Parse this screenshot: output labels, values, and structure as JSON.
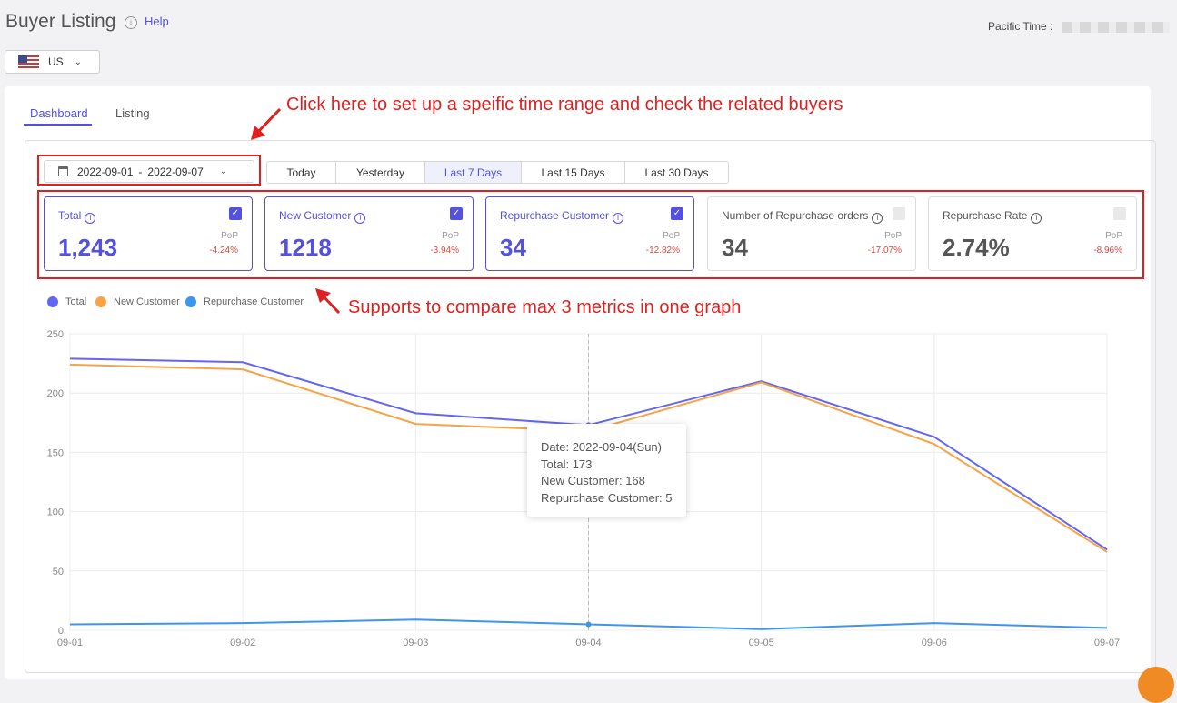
{
  "header": {
    "title": "Buyer Listing",
    "help": "Help",
    "pacific_label": "Pacific Time :"
  },
  "region": {
    "label": "US"
  },
  "tabs": [
    {
      "label": "Dashboard",
      "active": true
    },
    {
      "label": "Listing",
      "active": false
    }
  ],
  "date_range": {
    "start": "2022-09-01",
    "separator": "-",
    "end": "2022-09-07"
  },
  "quick_ranges": [
    {
      "label": "Today",
      "active": false
    },
    {
      "label": "Yesterday",
      "active": false
    },
    {
      "label": "Last 7 Days",
      "active": true
    },
    {
      "label": "Last 15 Days",
      "active": false
    },
    {
      "label": "Last 30 Days",
      "active": false
    }
  ],
  "metrics": [
    {
      "label": "Total",
      "value": "1,243",
      "pop_label": "PoP",
      "pop": "-4.24%",
      "selected": true
    },
    {
      "label": "New Customer",
      "value": "1218",
      "pop_label": "PoP",
      "pop": "-3.94%",
      "selected": true
    },
    {
      "label": "Repurchase Customer",
      "value": "34",
      "pop_label": "PoP",
      "pop": "-12.82%",
      "selected": true
    },
    {
      "label": "Number of Repurchase orders",
      "value": "34",
      "pop_label": "PoP",
      "pop": "-17.07%",
      "selected": false
    },
    {
      "label": "Repurchase Rate",
      "value": "2.74%",
      "pop_label": "PoP",
      "pop": "-8.96%",
      "selected": false
    }
  ],
  "annotations": {
    "time_range": "Click here to set up a speific time range and check the related buyers",
    "compare": "Supports to compare max 3 metrics in one graph"
  },
  "chart_data": {
    "type": "line",
    "x": [
      "09-01",
      "09-02",
      "09-03",
      "09-04",
      "09-05",
      "09-06",
      "09-07"
    ],
    "ylim": [
      0,
      250
    ],
    "yticks": [
      0,
      50,
      100,
      150,
      200,
      250
    ],
    "grid": true,
    "legend_position": "top-left",
    "series": [
      {
        "name": "Total",
        "color": "#6466f1",
        "values": [
          229,
          226,
          183,
          173,
          210,
          163,
          68
        ]
      },
      {
        "name": "New Customer",
        "color": "#f7a346",
        "values": [
          224,
          220,
          174,
          168,
          209,
          157,
          66
        ]
      },
      {
        "name": "Repurchase Customer",
        "color": "#3e96ec",
        "values": [
          5,
          6,
          9,
          5,
          1,
          6,
          2
        ]
      }
    ],
    "tooltip": {
      "date_label": "Date:",
      "date": "2022-09-04(Sun)",
      "total_label": "Total:",
      "total": "173",
      "new_label": "New Customer:",
      "new": "168",
      "repurchase_label": "Repurchase Customer:",
      "repurchase": "5"
    }
  }
}
